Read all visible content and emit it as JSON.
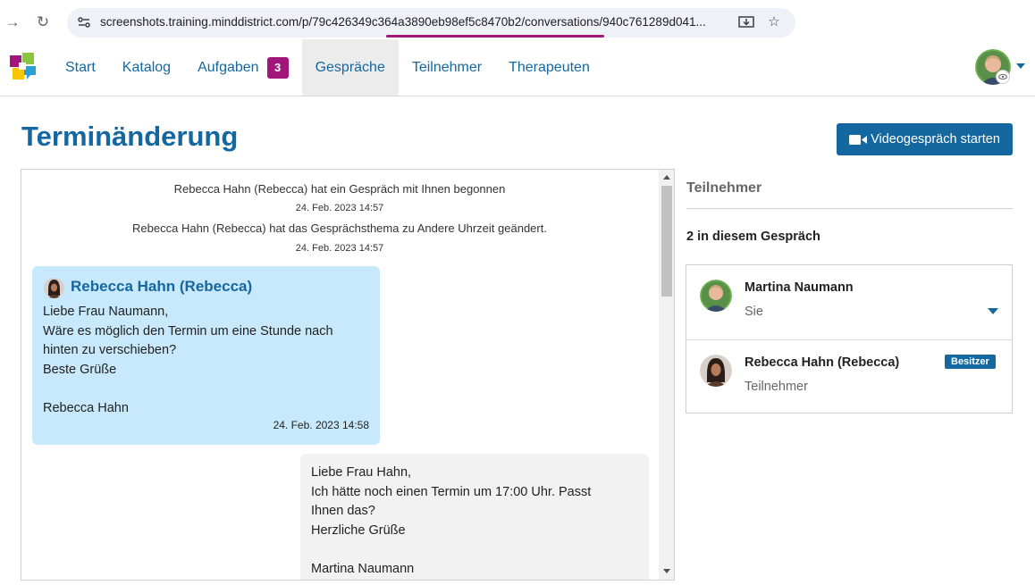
{
  "browser": {
    "url_host": "screenshots.training.minddistrict.com/p/",
    "url_id": "79c426349c364a3890eb98ef5c8470b2",
    "url_rest": "/conversations/940c761289d041..."
  },
  "nav": {
    "items": [
      {
        "label": "Start"
      },
      {
        "label": "Katalog"
      },
      {
        "label": "Aufgaben",
        "badge": "3"
      },
      {
        "label": "Gespräche",
        "active": true
      },
      {
        "label": "Teilnehmer"
      },
      {
        "label": "Therapeuten"
      }
    ]
  },
  "page": {
    "title": "Terminänderung",
    "video_button": "Videogespräch starten"
  },
  "conversation": {
    "system": [
      {
        "text": "Rebecca Hahn (Rebecca) hat ein Gespräch mit Ihnen begonnen",
        "time": "24. Feb. 2023 14:57"
      },
      {
        "text": "Rebecca Hahn (Rebecca) hat das Gesprächsthema zu Andere Uhrzeit geändert.",
        "time": "24. Feb. 2023 14:57"
      }
    ],
    "incoming": {
      "author": "Rebecca Hahn (Rebecca)",
      "body": "Liebe Frau Naumann,\nWäre es möglich den Termin um eine Stunde nach\nhinten zu verschieben?\nBeste Grüße\n\nRebecca Hahn",
      "time": "24. Feb. 2023 14:58"
    },
    "outgoing": {
      "body": "Liebe Frau Hahn,\nIch hätte noch einen Termin um 17:00 Uhr. Passt\nIhnen das?\nHerzliche Grüße\n\nMartina Naumann"
    }
  },
  "participants": {
    "heading": "Teilnehmer",
    "count_label": "2 in diesem Gespräch",
    "items": [
      {
        "name": "Martina Naumann",
        "role": "Sie"
      },
      {
        "name": "Rebecca Hahn (Rebecca)",
        "role": "Teilnehmer",
        "badge": "Besitzer"
      }
    ]
  },
  "colors": {
    "brand_blue": "#1567a0",
    "accent_purple": "#a2157b",
    "bubble_incoming": "#c8e8fb",
    "bubble_outgoing": "#f2f2f2"
  }
}
